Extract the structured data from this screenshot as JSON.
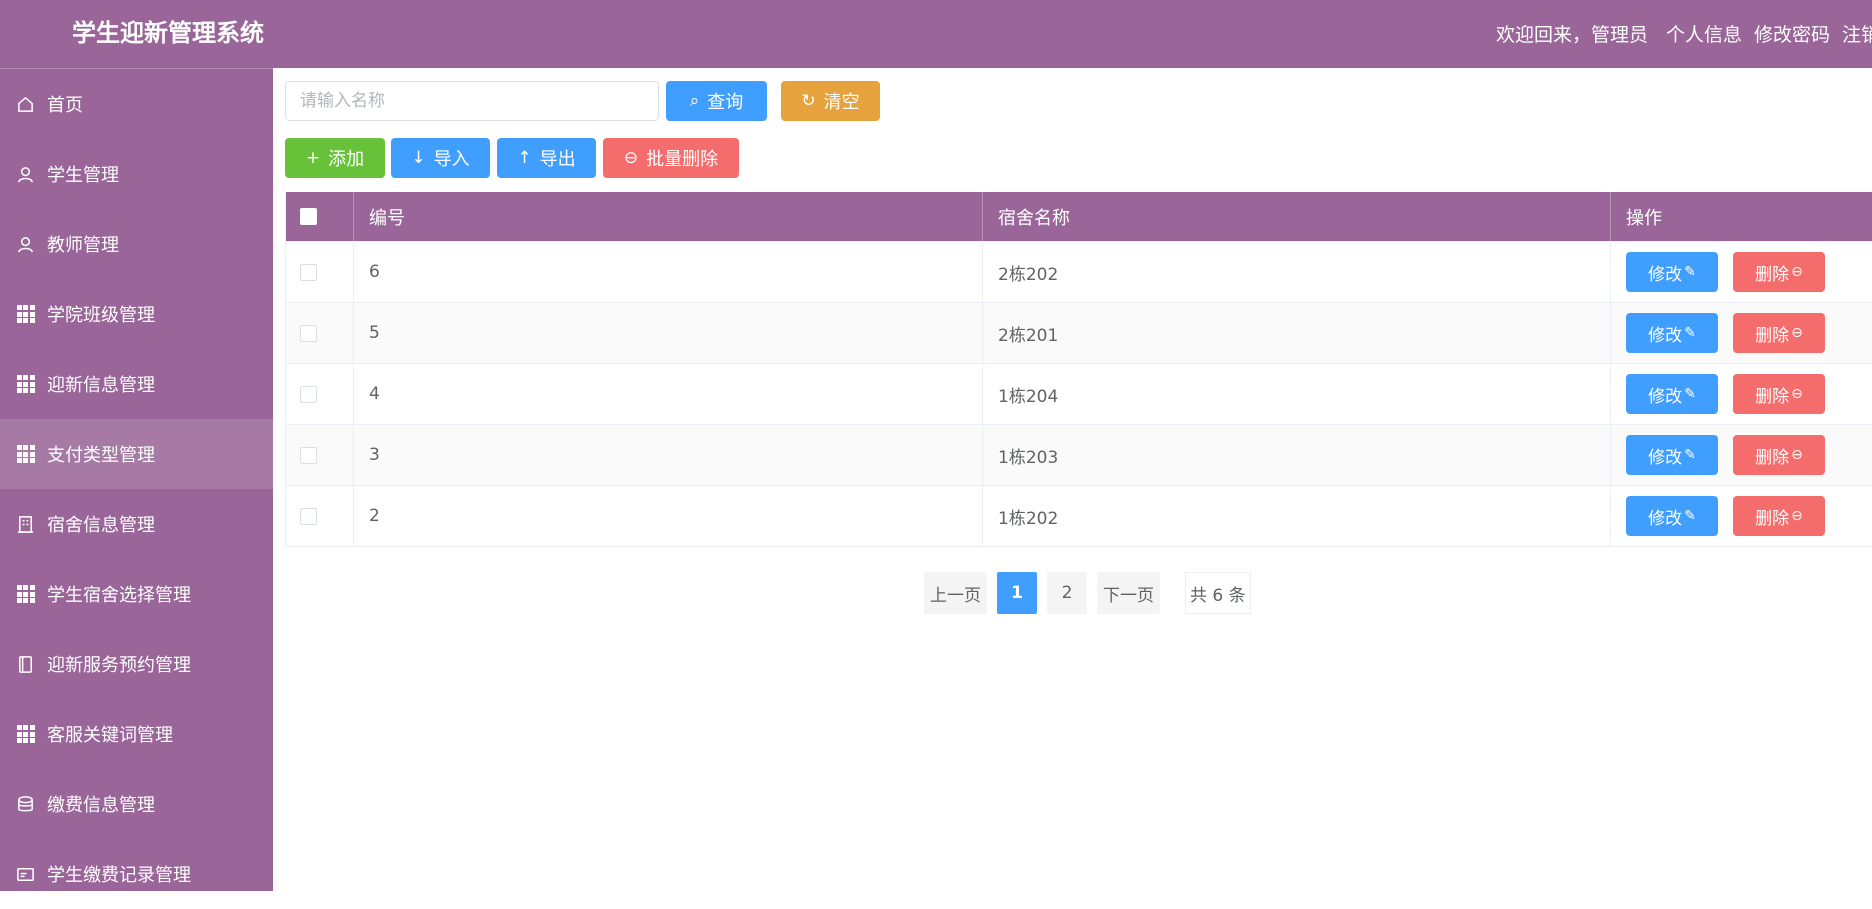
{
  "header": {
    "title": "学生迎新管理系统",
    "welcome": "欢迎回来，管理员",
    "profile": "个人信息",
    "change_password": "修改密码",
    "logout": "注销"
  },
  "sidebar": {
    "items": [
      {
        "label": "首页",
        "icon": "home-icon"
      },
      {
        "label": "学生管理",
        "icon": "user-icon"
      },
      {
        "label": "教师管理",
        "icon": "user-icon"
      },
      {
        "label": "学院班级管理",
        "icon": "grid-icon"
      },
      {
        "label": "迎新信息管理",
        "icon": "grid-icon"
      },
      {
        "label": "支付类型管理",
        "icon": "grid-icon"
      },
      {
        "label": "宿舍信息管理",
        "icon": "building-icon"
      },
      {
        "label": "学生宿舍选择管理",
        "icon": "grid-icon"
      },
      {
        "label": "迎新服务预约管理",
        "icon": "notebook-icon"
      },
      {
        "label": "客服关键词管理",
        "icon": "grid-icon"
      },
      {
        "label": "缴费信息管理",
        "icon": "database-icon"
      },
      {
        "label": "学生缴费记录管理",
        "icon": "card-icon"
      }
    ],
    "active_index": 5
  },
  "search": {
    "placeholder": "请输入名称",
    "value": "",
    "query_label": "查询",
    "clear_label": "清空"
  },
  "toolbar": {
    "add_label": "添加",
    "import_label": "导入",
    "export_label": "导出",
    "batch_delete_label": "批量删除"
  },
  "table": {
    "headers": {
      "id": "编号",
      "name": "宿舍名称",
      "ops": "操作"
    },
    "rows": [
      {
        "id": "6",
        "name": "2栋202"
      },
      {
        "id": "5",
        "name": "2栋201"
      },
      {
        "id": "4",
        "name": "1栋204"
      },
      {
        "id": "3",
        "name": "1栋203"
      },
      {
        "id": "2",
        "name": "1栋202"
      }
    ],
    "edit_label": "修改",
    "delete_label": "删除"
  },
  "pagination": {
    "prev": "上一页",
    "pages": [
      "1",
      "2"
    ],
    "current": "1",
    "next": "下一页",
    "total": "共 6 条"
  },
  "colors": {
    "brand": "#9a6699",
    "primary": "#409eff",
    "success": "#67c23a",
    "warning": "#e6a23c",
    "danger": "#f56c6c"
  }
}
